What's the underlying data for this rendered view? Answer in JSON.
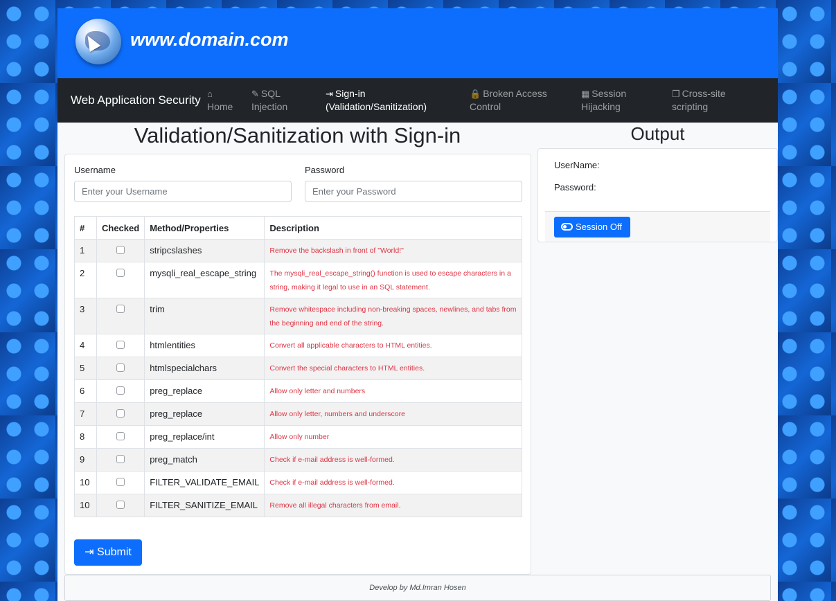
{
  "header": {
    "site_title": "www.domain.com",
    "logo_icon": "globe-cursor-icon"
  },
  "navbar": {
    "brand": "Web Application Security",
    "items": [
      {
        "icon": "home-icon",
        "glyph": "⌂",
        "line1": "",
        "line2": "Home"
      },
      {
        "icon": "syringe-icon",
        "glyph": "✎",
        "line1": "SQL",
        "line2": "Injection"
      },
      {
        "icon": "sign-in-icon",
        "glyph": "⇥",
        "line1": "Sign-in",
        "line2": "(Validation/Sanitization)"
      },
      {
        "icon": "lock-icon",
        "glyph": "🔒",
        "line1": "Broken Access",
        "line2": "Control"
      },
      {
        "icon": "building-icon",
        "glyph": "▦",
        "line1": "Session",
        "line2": "Hijacking"
      },
      {
        "icon": "copy-icon",
        "glyph": "❐",
        "line1": "Cross-site",
        "line2": "scripting"
      }
    ]
  },
  "main": {
    "title": "Validation/Sanitization with Sign-in",
    "username_label": "Username",
    "username_placeholder": "Enter your Username",
    "password_label": "Password",
    "password_placeholder": "Enter your Password",
    "table": {
      "headers": [
        "#",
        "Checked",
        "Method/Properties",
        "Description"
      ],
      "rows": [
        {
          "num": "1",
          "method": "stripcslashes",
          "desc": "Remove the backslash in front of \"World!\""
        },
        {
          "num": "2",
          "method": "mysqli_real_escape_string",
          "desc": "The mysqli_real_escape_string() function is used to escape characters in a string, making it legal to use in an SQL statement."
        },
        {
          "num": "3",
          "method": "trim",
          "desc": "Remove whitespace including non-breaking spaces, newlines, and tabs from the beginning and end of the string."
        },
        {
          "num": "4",
          "method": "htmlentities",
          "desc": "Convert all applicable characters to HTML entities."
        },
        {
          "num": "5",
          "method": "htmlspecialchars",
          "desc": "Convert the special characters to HTML entities."
        },
        {
          "num": "6",
          "method": "preg_replace",
          "desc": "Allow only letter and numbers"
        },
        {
          "num": "7",
          "method": "preg_replace",
          "desc": "Allow only letter, numbers and underscore"
        },
        {
          "num": "8",
          "method": "preg_replace/int",
          "desc": "Allow only number"
        },
        {
          "num": "9",
          "method": "preg_match",
          "desc": "Check if e-mail address is well-formed."
        },
        {
          "num": "10",
          "method": "FILTER_VALIDATE_EMAIL",
          "desc": "Check if e-mail address is well-formed."
        },
        {
          "num": "10",
          "method": "FILTER_SANITIZE_EMAIL",
          "desc": "Remove all illegal characters from email."
        }
      ]
    },
    "submit_label": "Submit"
  },
  "output": {
    "title": "Output",
    "username_line": "UserName:",
    "password_line": "Password:",
    "session_button": "Session Off"
  },
  "footer": {
    "text": "Develop by Md.Imran Hosen"
  },
  "colors": {
    "primary": "#0d6efd",
    "navbar": "#212529",
    "description_text": "#dc3545"
  }
}
